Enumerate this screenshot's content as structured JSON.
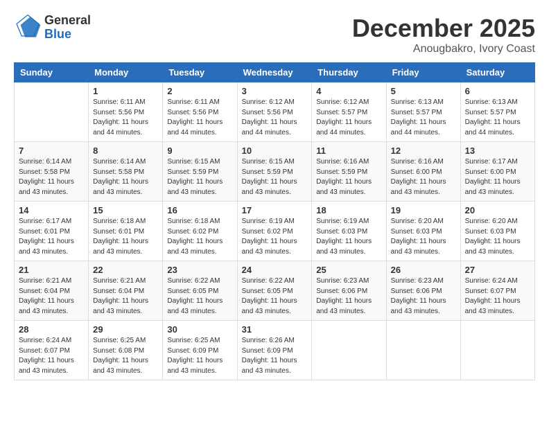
{
  "header": {
    "logo_general": "General",
    "logo_blue": "Blue",
    "month": "December 2025",
    "location": "Anougbakro, Ivory Coast"
  },
  "days_of_week": [
    "Sunday",
    "Monday",
    "Tuesday",
    "Wednesday",
    "Thursday",
    "Friday",
    "Saturday"
  ],
  "weeks": [
    [
      {
        "day": "",
        "sunrise": "",
        "sunset": "",
        "daylight": ""
      },
      {
        "day": "1",
        "sunrise": "Sunrise: 6:11 AM",
        "sunset": "Sunset: 5:56 PM",
        "daylight": "Daylight: 11 hours and 44 minutes."
      },
      {
        "day": "2",
        "sunrise": "Sunrise: 6:11 AM",
        "sunset": "Sunset: 5:56 PM",
        "daylight": "Daylight: 11 hours and 44 minutes."
      },
      {
        "day": "3",
        "sunrise": "Sunrise: 6:12 AM",
        "sunset": "Sunset: 5:56 PM",
        "daylight": "Daylight: 11 hours and 44 minutes."
      },
      {
        "day": "4",
        "sunrise": "Sunrise: 6:12 AM",
        "sunset": "Sunset: 5:57 PM",
        "daylight": "Daylight: 11 hours and 44 minutes."
      },
      {
        "day": "5",
        "sunrise": "Sunrise: 6:13 AM",
        "sunset": "Sunset: 5:57 PM",
        "daylight": "Daylight: 11 hours and 44 minutes."
      },
      {
        "day": "6",
        "sunrise": "Sunrise: 6:13 AM",
        "sunset": "Sunset: 5:57 PM",
        "daylight": "Daylight: 11 hours and 44 minutes."
      }
    ],
    [
      {
        "day": "7",
        "sunrise": "Sunrise: 6:14 AM",
        "sunset": "Sunset: 5:58 PM",
        "daylight": "Daylight: 11 hours and 43 minutes."
      },
      {
        "day": "8",
        "sunrise": "Sunrise: 6:14 AM",
        "sunset": "Sunset: 5:58 PM",
        "daylight": "Daylight: 11 hours and 43 minutes."
      },
      {
        "day": "9",
        "sunrise": "Sunrise: 6:15 AM",
        "sunset": "Sunset: 5:59 PM",
        "daylight": "Daylight: 11 hours and 43 minutes."
      },
      {
        "day": "10",
        "sunrise": "Sunrise: 6:15 AM",
        "sunset": "Sunset: 5:59 PM",
        "daylight": "Daylight: 11 hours and 43 minutes."
      },
      {
        "day": "11",
        "sunrise": "Sunrise: 6:16 AM",
        "sunset": "Sunset: 5:59 PM",
        "daylight": "Daylight: 11 hours and 43 minutes."
      },
      {
        "day": "12",
        "sunrise": "Sunrise: 6:16 AM",
        "sunset": "Sunset: 6:00 PM",
        "daylight": "Daylight: 11 hours and 43 minutes."
      },
      {
        "day": "13",
        "sunrise": "Sunrise: 6:17 AM",
        "sunset": "Sunset: 6:00 PM",
        "daylight": "Daylight: 11 hours and 43 minutes."
      }
    ],
    [
      {
        "day": "14",
        "sunrise": "Sunrise: 6:17 AM",
        "sunset": "Sunset: 6:01 PM",
        "daylight": "Daylight: 11 hours and 43 minutes."
      },
      {
        "day": "15",
        "sunrise": "Sunrise: 6:18 AM",
        "sunset": "Sunset: 6:01 PM",
        "daylight": "Daylight: 11 hours and 43 minutes."
      },
      {
        "day": "16",
        "sunrise": "Sunrise: 6:18 AM",
        "sunset": "Sunset: 6:02 PM",
        "daylight": "Daylight: 11 hours and 43 minutes."
      },
      {
        "day": "17",
        "sunrise": "Sunrise: 6:19 AM",
        "sunset": "Sunset: 6:02 PM",
        "daylight": "Daylight: 11 hours and 43 minutes."
      },
      {
        "day": "18",
        "sunrise": "Sunrise: 6:19 AM",
        "sunset": "Sunset: 6:03 PM",
        "daylight": "Daylight: 11 hours and 43 minutes."
      },
      {
        "day": "19",
        "sunrise": "Sunrise: 6:20 AM",
        "sunset": "Sunset: 6:03 PM",
        "daylight": "Daylight: 11 hours and 43 minutes."
      },
      {
        "day": "20",
        "sunrise": "Sunrise: 6:20 AM",
        "sunset": "Sunset: 6:03 PM",
        "daylight": "Daylight: 11 hours and 43 minutes."
      }
    ],
    [
      {
        "day": "21",
        "sunrise": "Sunrise: 6:21 AM",
        "sunset": "Sunset: 6:04 PM",
        "daylight": "Daylight: 11 hours and 43 minutes."
      },
      {
        "day": "22",
        "sunrise": "Sunrise: 6:21 AM",
        "sunset": "Sunset: 6:04 PM",
        "daylight": "Daylight: 11 hours and 43 minutes."
      },
      {
        "day": "23",
        "sunrise": "Sunrise: 6:22 AM",
        "sunset": "Sunset: 6:05 PM",
        "daylight": "Daylight: 11 hours and 43 minutes."
      },
      {
        "day": "24",
        "sunrise": "Sunrise: 6:22 AM",
        "sunset": "Sunset: 6:05 PM",
        "daylight": "Daylight: 11 hours and 43 minutes."
      },
      {
        "day": "25",
        "sunrise": "Sunrise: 6:23 AM",
        "sunset": "Sunset: 6:06 PM",
        "daylight": "Daylight: 11 hours and 43 minutes."
      },
      {
        "day": "26",
        "sunrise": "Sunrise: 6:23 AM",
        "sunset": "Sunset: 6:06 PM",
        "daylight": "Daylight: 11 hours and 43 minutes."
      },
      {
        "day": "27",
        "sunrise": "Sunrise: 6:24 AM",
        "sunset": "Sunset: 6:07 PM",
        "daylight": "Daylight: 11 hours and 43 minutes."
      }
    ],
    [
      {
        "day": "28",
        "sunrise": "Sunrise: 6:24 AM",
        "sunset": "Sunset: 6:07 PM",
        "daylight": "Daylight: 11 hours and 43 minutes."
      },
      {
        "day": "29",
        "sunrise": "Sunrise: 6:25 AM",
        "sunset": "Sunset: 6:08 PM",
        "daylight": "Daylight: 11 hours and 43 minutes."
      },
      {
        "day": "30",
        "sunrise": "Sunrise: 6:25 AM",
        "sunset": "Sunset: 6:09 PM",
        "daylight": "Daylight: 11 hours and 43 minutes."
      },
      {
        "day": "31",
        "sunrise": "Sunrise: 6:26 AM",
        "sunset": "Sunset: 6:09 PM",
        "daylight": "Daylight: 11 hours and 43 minutes."
      },
      {
        "day": "",
        "sunrise": "",
        "sunset": "",
        "daylight": ""
      },
      {
        "day": "",
        "sunrise": "",
        "sunset": "",
        "daylight": ""
      },
      {
        "day": "",
        "sunrise": "",
        "sunset": "",
        "daylight": ""
      }
    ]
  ]
}
